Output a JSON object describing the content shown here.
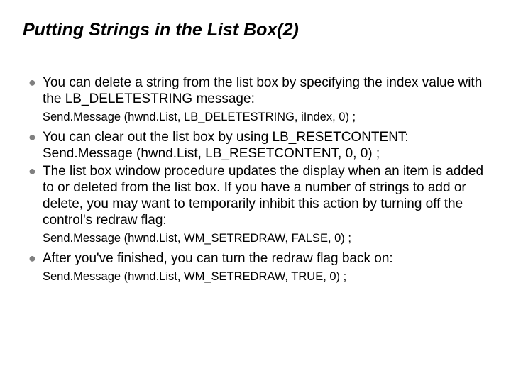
{
  "title": "Putting Strings in the List Box(2)",
  "bullets": {
    "b1": "You can delete a string from the list box by specifying the index value with the LB_DELETESTRING message:",
    "c1": "Send.Message (hwnd.List, LB_DELETESTRING, iIndex, 0) ;",
    "b2a": "You can clear out the list box by using LB_RESETCONTENT:",
    "b2b": "Send.Message (hwnd.List, LB_RESETCONTENT, 0, 0) ;",
    "b3": "The list box window procedure updates the display when an item is added to or deleted from the list box. If you have a number of strings to add or delete, you may want to temporarily inhibit this action by turning off the control's redraw flag:",
    "c3": "Send.Message (hwnd.List, WM_SETREDRAW, FALSE, 0) ;",
    "b4": "After you've finished, you can turn the redraw flag back on:",
    "c4": "Send.Message (hwnd.List, WM_SETREDRAW, TRUE, 0) ;"
  }
}
